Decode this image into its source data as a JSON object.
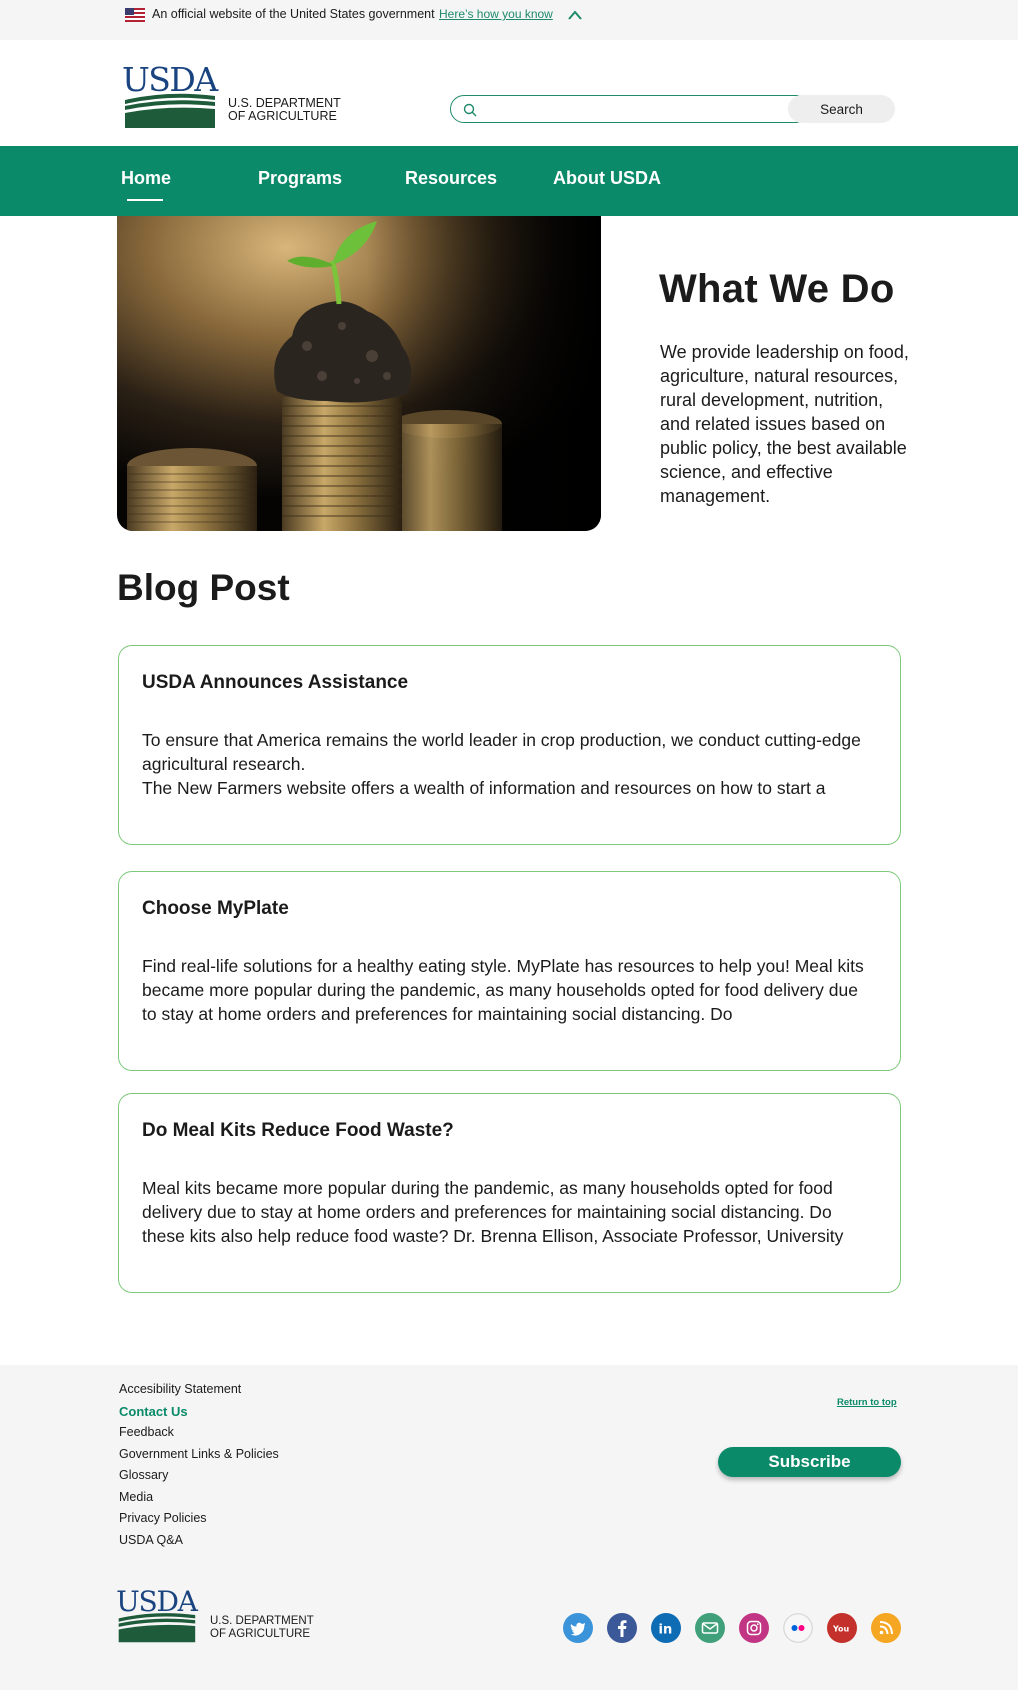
{
  "gov_banner": {
    "text": "An official website of the United States government",
    "link": "Here’s how you know"
  },
  "header": {
    "logo_text": "USDA",
    "dept_line1": "U.S. DEPARTMENT",
    "dept_line2": "OF AGRICULTURE",
    "search": {
      "placeholder": "",
      "value": "",
      "button": "Search"
    }
  },
  "nav": {
    "items": [
      {
        "label": "Home",
        "active": true
      },
      {
        "label": "Programs"
      },
      {
        "label": "Resources"
      },
      {
        "label": "About USDA"
      }
    ]
  },
  "hero": {
    "title": "What We Do",
    "body": "We provide leadership on food, agriculture, natural resources, rural development, nutrition, and related issues based on public policy, the best available science, and effective management."
  },
  "blog": {
    "title": "Blog Post",
    "posts": [
      {
        "title": "USDA Announces Assistance",
        "body": "To ensure that America remains the world leader in crop production, we conduct cutting-edge agricultural research.\nThe New Farmers website offers a wealth of information and resources on how to start a"
      },
      {
        "title": "Choose MyPlate",
        "body": "Find real-life solutions for a healthy eating style. MyPlate has resources to help you! Meal kits became more popular during the pandemic, as many households opted for food delivery due to stay at home orders and preferences for maintaining social distancing. Do"
      },
      {
        "title": "Do Meal Kits Reduce Food Waste?",
        "body": "Meal kits became more popular during the pandemic, as many households opted for food delivery due to stay at home orders and preferences for maintaining social distancing. Do these kits also help reduce food waste? Dr. Brenna Ellison, Associate Professor, University"
      }
    ]
  },
  "footer": {
    "links": [
      "Accesibility Statement",
      "Contact Us",
      "Feedback",
      "Government Links & Policies",
      "Glossary",
      "Media",
      "Privacy Policies",
      "USDA Q&A"
    ],
    "active_link": "Contact Us",
    "return_to_top": "Return to top",
    "subscribe": "Subscribe",
    "logo_text": "USDA",
    "dept_line1": "U.S. DEPARTMENT",
    "dept_line2": "OF AGRICULTURE",
    "social": [
      "twitter-icon",
      "facebook-icon",
      "linkedin-icon",
      "email-icon",
      "instagram-icon",
      "flickr-icon",
      "youtube-icon",
      "rss-icon"
    ]
  },
  "colors": {
    "brand_green": "#0b8a6a",
    "usda_blue": "#1a4480",
    "usda_green": "#1e5b3a",
    "card_border": "#7cc97c"
  }
}
